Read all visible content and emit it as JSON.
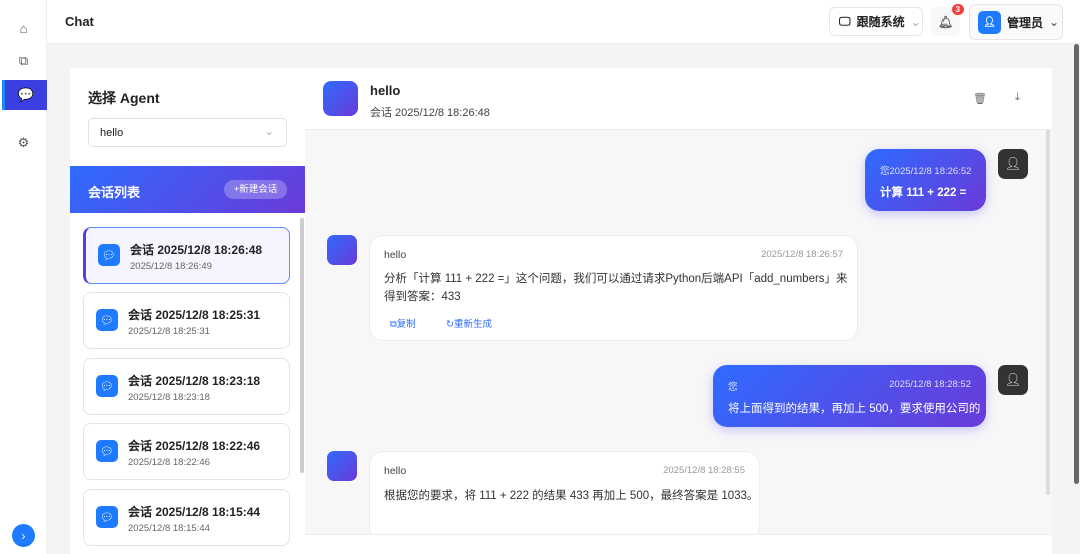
{
  "app": {
    "title": "Chat"
  },
  "topbar": {
    "system_label": "跟随系统",
    "notification_count": "3",
    "user_name": "管理员"
  },
  "sidebar": {
    "agent_title": "选择 Agent",
    "agent_value": "hello",
    "list_title": "会话列表",
    "new_session": "+新建会话",
    "sessions": [
      {
        "title": "会话 2025/12/8 18:26:48",
        "time": "2025/12/8 18:26:49"
      },
      {
        "title": "会话 2025/12/8 18:25:31",
        "time": "2025/12/8 18:25:31"
      },
      {
        "title": "会话 2025/12/8 18:23:18",
        "time": "2025/12/8 18:23:18"
      },
      {
        "title": "会话 2025/12/8 18:22:46",
        "time": "2025/12/8 18:22:46"
      },
      {
        "title": "会话 2025/12/8 18:15:44",
        "time": "2025/12/8 18:15:44"
      }
    ]
  },
  "chat": {
    "title": "hello",
    "subtitle": "会话 2025/12/8 18:26:48",
    "messages": [
      {
        "sender": "您",
        "time": "2025/12/8 18:26:52",
        "text": "计算 111 + 222 ="
      },
      {
        "sender": "hello",
        "time": "2025/12/8 18:26:57",
        "text": "分析「计算 111 + 222 =」这个问题，我们可以通过请求Python后端API「add_numbers」来得到答案：433",
        "copy": "复制",
        "regen": "重新生成"
      },
      {
        "sender": "您",
        "time": "2025/12/8 18:28:52",
        "text": "将上面得到的结果，再加上 500，要求使用公司的"
      },
      {
        "sender": "hello",
        "time": "2025/12/8 18:28:55",
        "text": "根据您的要求，将 111 + 222 的结果 433 再加上 500，最终答案是 1033。"
      }
    ]
  }
}
